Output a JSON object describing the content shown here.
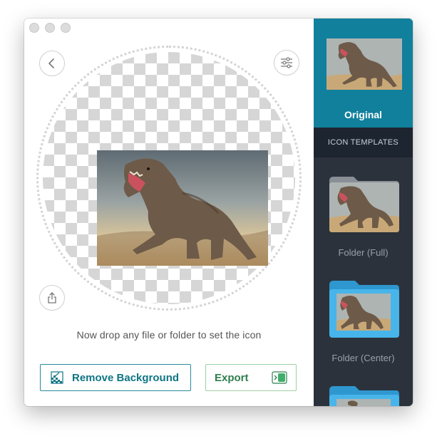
{
  "window": {
    "traffic_lights": [
      "close",
      "minimize",
      "zoom"
    ]
  },
  "toolbar": {
    "back_icon": "chevron-left-icon",
    "settings_icon": "sliders-icon",
    "share_icon": "share-icon"
  },
  "main": {
    "hint": "Now drop any file or folder to set the icon",
    "remove_background_label": "Remove Background",
    "export_label": "Export"
  },
  "sidebar": {
    "original_label": "Original",
    "templates_header": "ICON TEMPLATES",
    "templates": [
      {
        "label": "Folder (Full)"
      },
      {
        "label": "Folder (Center)"
      },
      {
        "label": ""
      }
    ]
  },
  "colors": {
    "accent_teal": "#11809c",
    "sidebar_bg": "#2b323c",
    "folder_blue": "#3fb0e8"
  }
}
